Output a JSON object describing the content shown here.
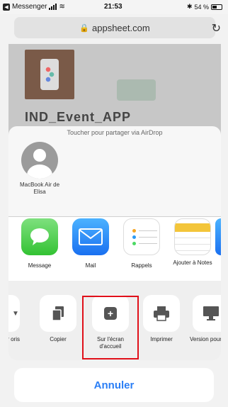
{
  "status_bar": {
    "back_app": "Messenger",
    "time": "21:53",
    "battery_text": "54 %",
    "battery_level": 0.54
  },
  "browser": {
    "url": "appsheet.com"
  },
  "background_page": {
    "title": "IND_Event_APP"
  },
  "share_sheet": {
    "airdrop_hint": "Toucher pour partager via AirDrop",
    "airdrop_device": "MacBook Air de Elisa",
    "apps": [
      {
        "label": "Message",
        "icon": "messages-icon"
      },
      {
        "label": "Mail",
        "icon": "mail-icon"
      },
      {
        "label": "Rappels",
        "icon": "reminders-icon"
      },
      {
        "label": "Ajouter à Notes",
        "icon": "notes-icon"
      }
    ],
    "actions": [
      {
        "label": "er oris",
        "icon": "partial-action-icon"
      },
      {
        "label": "Copier",
        "icon": "copy-icon"
      },
      {
        "label": "Sur l'écran d'accueil",
        "icon": "add-to-home-icon"
      },
      {
        "label": "Imprimer",
        "icon": "print-icon"
      },
      {
        "label": "Version pour bureau du site",
        "icon": "desktop-icon"
      }
    ],
    "cancel_label": "Annuler"
  },
  "colors": {
    "highlight": "#e0101a",
    "link_blue": "#2a7ef5"
  }
}
